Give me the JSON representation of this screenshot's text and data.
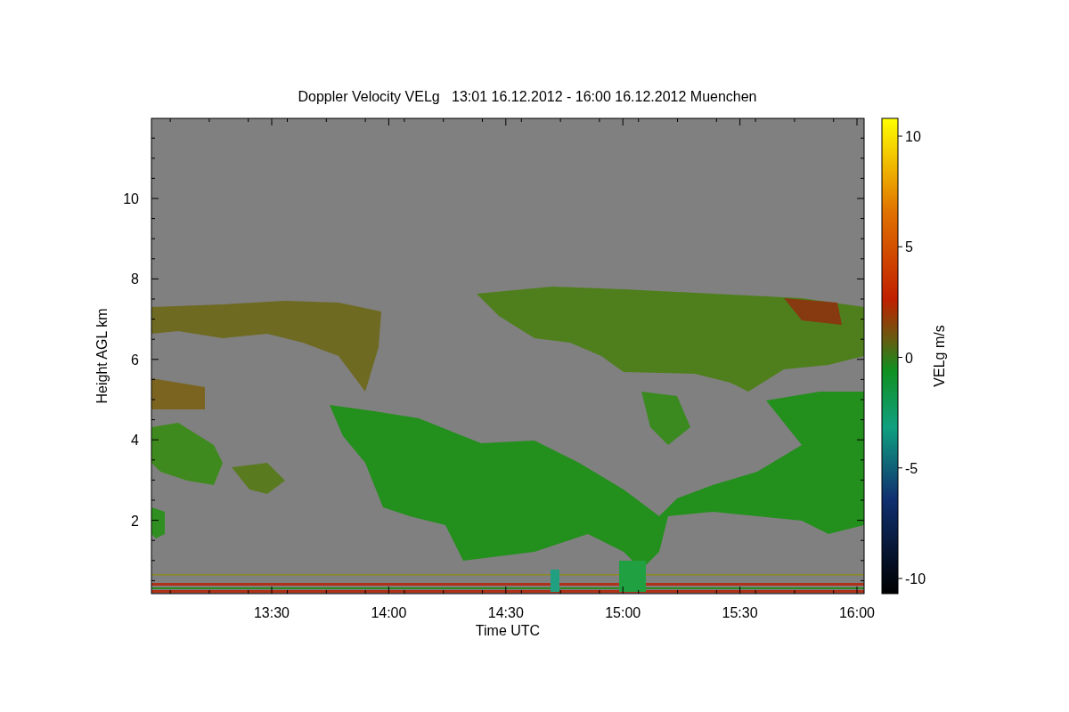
{
  "title": "Doppler Velocity VELg   13:01 16.12.2012 - 16:00 16.12.2012 Muenchen",
  "plot": {
    "ylabel": "Height AGL km",
    "xlabel": "Time UTC",
    "yticks": [
      "10",
      "8",
      "6",
      "4",
      "2"
    ],
    "xticks": [
      "13:30",
      "14:00",
      "14:30",
      "15:00",
      "15:30",
      "16:00"
    ]
  },
  "colorbar": {
    "label": "VELg m/s",
    "ticks": [
      "10",
      "5",
      "0",
      "-5",
      "-10"
    ]
  }
}
